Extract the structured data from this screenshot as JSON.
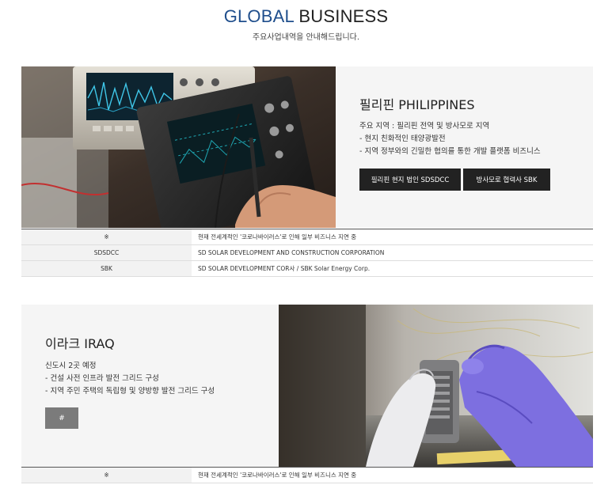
{
  "header": {
    "title_accent": "GLOBAL",
    "title_rest": " BUSINESS",
    "subtitle": "주요사업내역을 안내해드립니다."
  },
  "philippines": {
    "title": "필리핀 PHILIPPINES",
    "desc": [
      "주요 지역 : 필리핀 전역 및 방사모로 지역",
      "- 현지 친화적인 태양광발전",
      "- 지역 정부와의 긴밀한 협의를 통한 개발 플랫폼 비즈니스"
    ],
    "buttons": [
      "필리핀 현지 법인 SDSDCC",
      "방사모로 협력사 SBK"
    ],
    "table": [
      {
        "key": "※",
        "value": "현재 전세계적인 '코로나바이러스'로 인해 일부 비즈니스 지연 중"
      },
      {
        "key": "SDSDCC",
        "value": "SD SOLAR DEVELOPMENT AND CONSTRUCTION CORPORATION"
      },
      {
        "key": "SBK",
        "value": "SD SOLAR DEVELOPMENT COR사 / SBK Solar Energy Corp."
      }
    ]
  },
  "iraq": {
    "title": "이라크 IRAQ",
    "desc": [
      "신도시 2곳 예정",
      "- 건설 사전 인프라 발전 그리드 구성",
      "- 지역 주민 주택의 독립형 및 양방향 발전 그리드 구성"
    ],
    "button": "#",
    "table": [
      {
        "key": "※",
        "value": "현재 전세계적인 '코로나바이러스'로 인해 일부 비즈니스 지연 중"
      }
    ]
  }
}
